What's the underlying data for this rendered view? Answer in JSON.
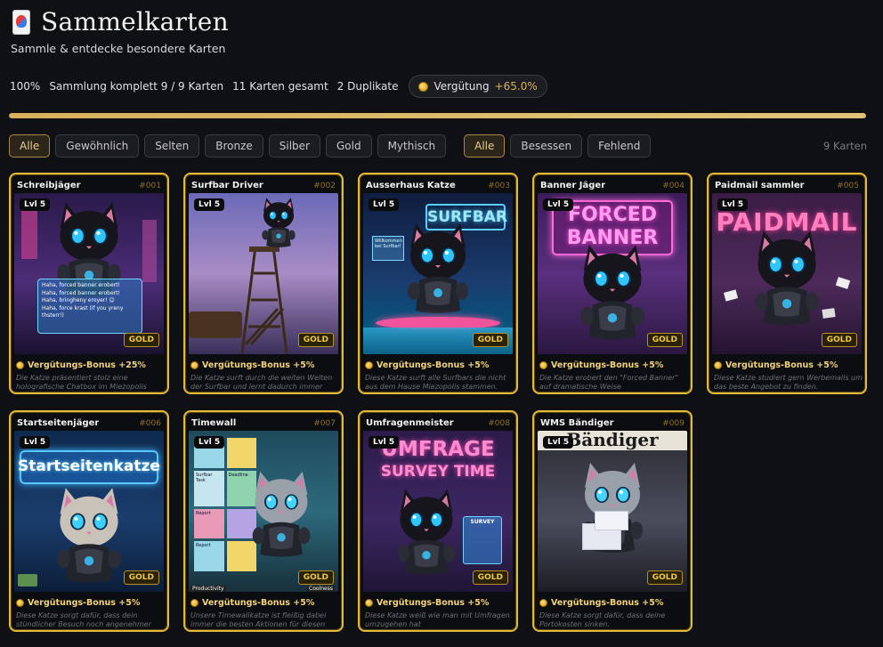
{
  "header": {
    "title": "Sammelkarten",
    "subtitle": "Sammle & entdecke besondere Karten"
  },
  "stats": {
    "percent": "100%",
    "collection": "Sammlung komplett 9 / 9 Karten",
    "total": "11 Karten gesamt",
    "duplicates": "2 Duplikate",
    "reward_label": "Vergütung",
    "reward_value": "+65.0%",
    "progress": 1.0
  },
  "filters": {
    "rarity": [
      "Alle",
      "Gewöhnlich",
      "Selten",
      "Bronze",
      "Silber",
      "Gold",
      "Mythisch"
    ],
    "rarity_active": "Alle",
    "ownership": [
      "Alle",
      "Besessen",
      "Fehlend"
    ],
    "ownership_active": "Alle",
    "count": "9 Karten"
  },
  "colors": {
    "gold_border": "#e2b93b",
    "accent": "#d7b15c",
    "background": "#0f1014"
  },
  "cards": [
    {
      "name": "Schreibjäger",
      "num": "#001",
      "level": "Lvl 5",
      "rarity": "GOLD",
      "bonus": "Vergütungs-Bonus +25%",
      "desc": "Die Katze präsentiert stolz eine holografische Chatbox im Miezopolis",
      "scene": "chat",
      "art_text": [
        "Haha, forced banner erobert!",
        "Haha, forced banner erobert!",
        "Haha, bringheny eroyer! 😊",
        "Haha, force krast (if you yreny thsterr!)"
      ]
    },
    {
      "name": "Surfbar Driver",
      "num": "#002",
      "level": "Lvl 5",
      "rarity": "GOLD",
      "bonus": "Vergütungs-Bonus +5%",
      "desc": "Die Katze surft durch die weiten Welten der Surfbar und lernt dadurch immer mehr Seiten kennen",
      "scene": "tower",
      "art_text": []
    },
    {
      "name": "Ausserhaus Katze",
      "num": "#003",
      "level": "Lvl 5",
      "rarity": "GOLD",
      "bonus": "Vergütungs-Bonus +5%",
      "desc": "Diese Katze surft alle Surfbars die nicht aus dem Hause Miezopolis stammen.",
      "scene": "surf",
      "art_text": [
        "SURFBAR",
        "Willkommen bei Surfbar!"
      ]
    },
    {
      "name": "Banner Jäger",
      "num": "#004",
      "level": "Lvl 5",
      "rarity": "GOLD",
      "bonus": "Vergütungs-Bonus +5%",
      "desc": "Die Katze erobert den \"Forced Banner\" auf dramatische Weise",
      "scene": "banner",
      "art_text": [
        "FORCED",
        "BANNER"
      ]
    },
    {
      "name": "Paidmail sammler",
      "num": "#005",
      "level": "Lvl 5",
      "rarity": "GOLD",
      "bonus": "Vergütungs-Bonus +5%",
      "desc": "Diese Katze studiert gern Werbemails um das beste Angebot zu finden.",
      "scene": "paidmail",
      "art_text": [
        "PAIDMAIL"
      ]
    },
    {
      "name": "Startseitenjäger",
      "num": "#006",
      "level": "Lvl 5",
      "rarity": "GOLD",
      "bonus": "Vergütungs-Bonus +5%",
      "desc": "Diese Katze sorgt dafür, dass dein stündlicher Besuch noch angenehmer wird.",
      "scene": "start",
      "art_text": [
        "Startseitenkatze"
      ]
    },
    {
      "name": "Timewall",
      "num": "#007",
      "level": "Lvl 5",
      "rarity": "GOLD",
      "bonus": "Vergütungs-Bonus +5%",
      "desc": "Unsere Timewallkatze ist fleißig dabei immer die besten Aktionen für diesen Anbieter zu finden",
      "scene": "timewall",
      "art_text": [
        "Productivity",
        "Coolness",
        "Code",
        "Surfbar Task",
        "Deadline",
        "Report",
        "Report"
      ]
    },
    {
      "name": "Umfragenmeister",
      "num": "#008",
      "level": "Lvl 5",
      "rarity": "GOLD",
      "bonus": "Vergütungs-Bonus +5%",
      "desc": "Diese Katze weiß wie man mit Umfragen umzugehen hat",
      "scene": "survey",
      "art_text": [
        "UMFRAGE",
        "SURVEY TIME",
        "SURVEY"
      ]
    },
    {
      "name": "WMS Bändiger",
      "num": "#009",
      "level": "Lvl 5",
      "rarity": "GOLD",
      "bonus": "Vergütungs-Bonus +5%",
      "desc": "Diese Katze sorgt dafür, dass deine Portokosten sinken.",
      "scene": "wms",
      "art_text": [
        "Bändiger"
      ]
    }
  ]
}
